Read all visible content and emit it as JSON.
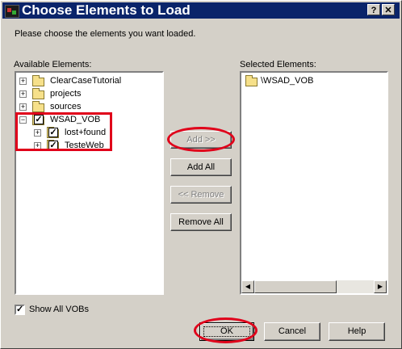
{
  "window": {
    "title": "Choose Elements to Load",
    "help_glyph": "?",
    "close_glyph": "✕"
  },
  "instructions": "Please choose the elements you want loaded.",
  "available": {
    "label": "Available Elements:",
    "items": [
      {
        "label": "ClearCaseTutorial",
        "expander": "+",
        "icon": "folder-icon"
      },
      {
        "label": "projects",
        "expander": "+",
        "icon": "folder-icon"
      },
      {
        "label": "sources",
        "expander": "+",
        "icon": "folder-icon"
      },
      {
        "label": "WSAD_VOB",
        "expander": "−",
        "icon": "checked-folder-icon",
        "children": [
          {
            "label": "lost+found",
            "expander": "+",
            "icon": "checked-folder-icon"
          },
          {
            "label": "TesteWeb",
            "expander": "+",
            "icon": "checked-folder-icon"
          }
        ]
      }
    ]
  },
  "selected": {
    "label": "Selected Elements:",
    "items": [
      {
        "label": "\\WSAD_VOB",
        "icon": "folder-icon"
      }
    ]
  },
  "buttons": {
    "add": "Add >>",
    "add_all": "Add All",
    "remove": "<< Remove",
    "remove_all": "Remove All",
    "ok": "OK",
    "cancel": "Cancel",
    "help": "Help"
  },
  "show_all_vobs": {
    "label": "Show All VOBs",
    "checked": true,
    "glyph": "✓"
  },
  "scrollbar": {
    "left_arrow": "◀",
    "right_arrow": "▶"
  },
  "annotation_color": "#e0001a"
}
